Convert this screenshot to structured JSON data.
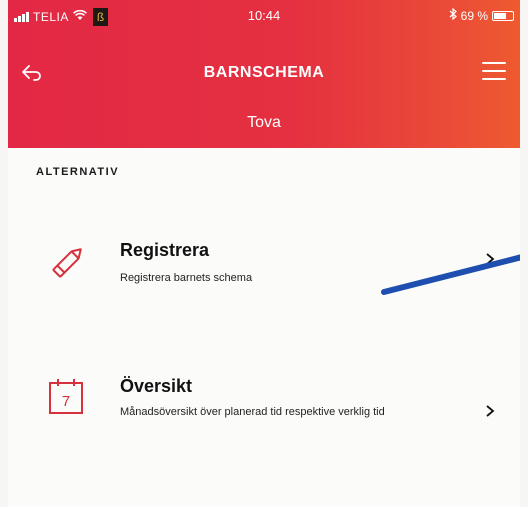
{
  "status_bar": {
    "carrier": "TELIA",
    "notification": "ß",
    "time": "10:44",
    "battery_text": "69 %",
    "battery_level": 0.69
  },
  "nav": {
    "title": "BARNSCHEMA",
    "back_icon": "back-arrow-icon",
    "menu_icon": "hamburger-menu-icon"
  },
  "child": {
    "name": "Tova"
  },
  "section": {
    "label": "ALTERNATIV"
  },
  "options": [
    {
      "title": "Registrera",
      "description": "Registrera barnets schema",
      "icon": "pencil-icon"
    },
    {
      "title": "Översikt",
      "description": "Månadsöversikt över planerad tid respektive verklig tid",
      "icon": "calendar-icon",
      "icon_text": "7"
    }
  ],
  "colors": {
    "header_start": "#e32845",
    "header_end": "#ee5a30",
    "accent": "#d6313c",
    "pen_mark": "#1e4fb0"
  }
}
